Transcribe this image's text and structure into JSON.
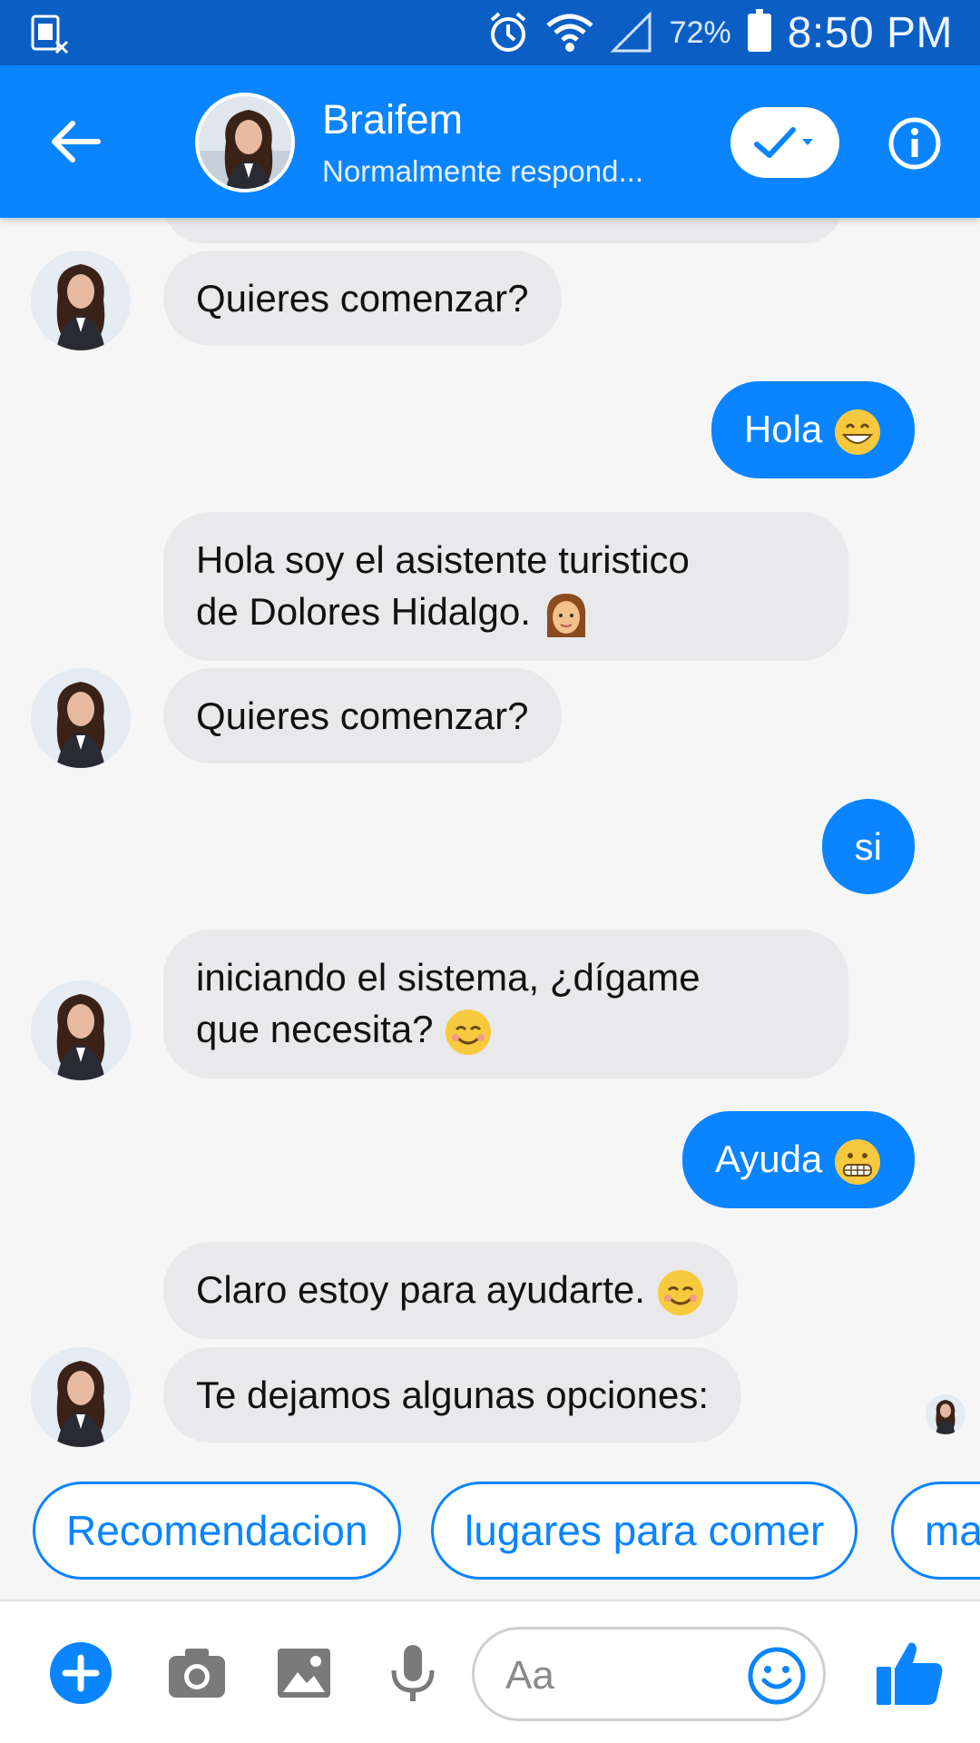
{
  "status_bar": {
    "battery_percent": "72%",
    "time": "8:50 PM",
    "icons": [
      "sim-card-icon",
      "alarm-icon",
      "wifi-icon",
      "signal-icon",
      "battery-icon"
    ]
  },
  "header": {
    "name": "Braifem",
    "subtitle": "Normalmente respond...",
    "accent_color": "#0a84ff"
  },
  "messages": [
    {
      "from": "bot",
      "text": "Quieres comenzar?"
    },
    {
      "from": "user",
      "text": "Hola",
      "emoji": "grinning-face"
    },
    {
      "from": "bot",
      "text_line1": "Hola soy el asistente turistico",
      "text_line2": "de Dolores Hidalgo.",
      "emoji": "woman-face"
    },
    {
      "from": "bot",
      "text": "Quieres comenzar?"
    },
    {
      "from": "user",
      "text": "si"
    },
    {
      "from": "bot",
      "text_line1": "iniciando el sistema, ¿dígame",
      "text_line2": "que necesita?",
      "emoji": "smiling-face"
    },
    {
      "from": "user",
      "text": "Ayuda",
      "emoji": "grimacing-face"
    },
    {
      "from": "bot",
      "text": "Claro estoy para ayudarte.",
      "emoji": "smiling-face"
    },
    {
      "from": "bot",
      "text": "Te dejamos algunas opciones:"
    }
  ],
  "quick_replies": [
    "Recomendacion",
    "lugares para comer",
    "ma"
  ],
  "composer": {
    "placeholder": "Aa"
  }
}
